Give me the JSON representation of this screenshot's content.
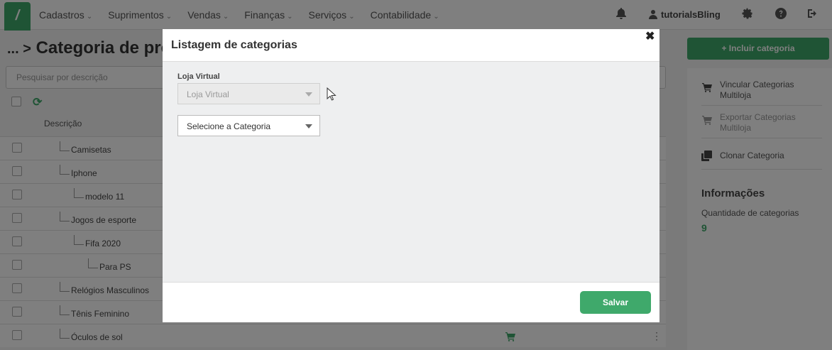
{
  "nav": {
    "items": [
      {
        "label": "Cadastros"
      },
      {
        "label": "Suprimentos"
      },
      {
        "label": "Vendas"
      },
      {
        "label": "Finanças"
      },
      {
        "label": "Serviços"
      },
      {
        "label": "Contabilidade"
      }
    ],
    "caret": "⌄",
    "username": "tutorialsBling"
  },
  "page": {
    "breadcrumb": "... >",
    "title": "Categoria de pro",
    "search_placeholder": "Pesquisar por descrição",
    "column_description": "Descrição",
    "rows": [
      {
        "label": "Camisetas",
        "depth": 0
      },
      {
        "label": "Iphone",
        "depth": 0
      },
      {
        "label": "modelo 11",
        "depth": 1
      },
      {
        "label": "Jogos de esporte",
        "depth": 0
      },
      {
        "label": "Fifa 2020",
        "depth": 1
      },
      {
        "label": "Para PS",
        "depth": 2
      },
      {
        "label": "Relógios Masculinos",
        "depth": 0
      },
      {
        "label": "Tênis Feminino",
        "depth": 0
      },
      {
        "label": "Óculos de sol",
        "depth": 0
      }
    ]
  },
  "sidebar": {
    "add_button": "+ Incluir categoria",
    "link_multistore": "Vincular Categorias Multiloja",
    "export_multistore": "Exportar Categorias Multiloja",
    "clone_category": "Clonar Categoria",
    "info_title": "Informações",
    "info_label": "Quantidade de categorias",
    "info_value": "9"
  },
  "modal": {
    "title": "Listagem de categorias",
    "close": "✖",
    "store_label": "Loja Virtual",
    "store_value": "Loja Virtual",
    "category_value": "Selecione a Categoria",
    "save_button": "Salvar"
  },
  "colors": {
    "accent": "#3fa96b",
    "overlay": "rgba(0,0,0,0.5)"
  }
}
